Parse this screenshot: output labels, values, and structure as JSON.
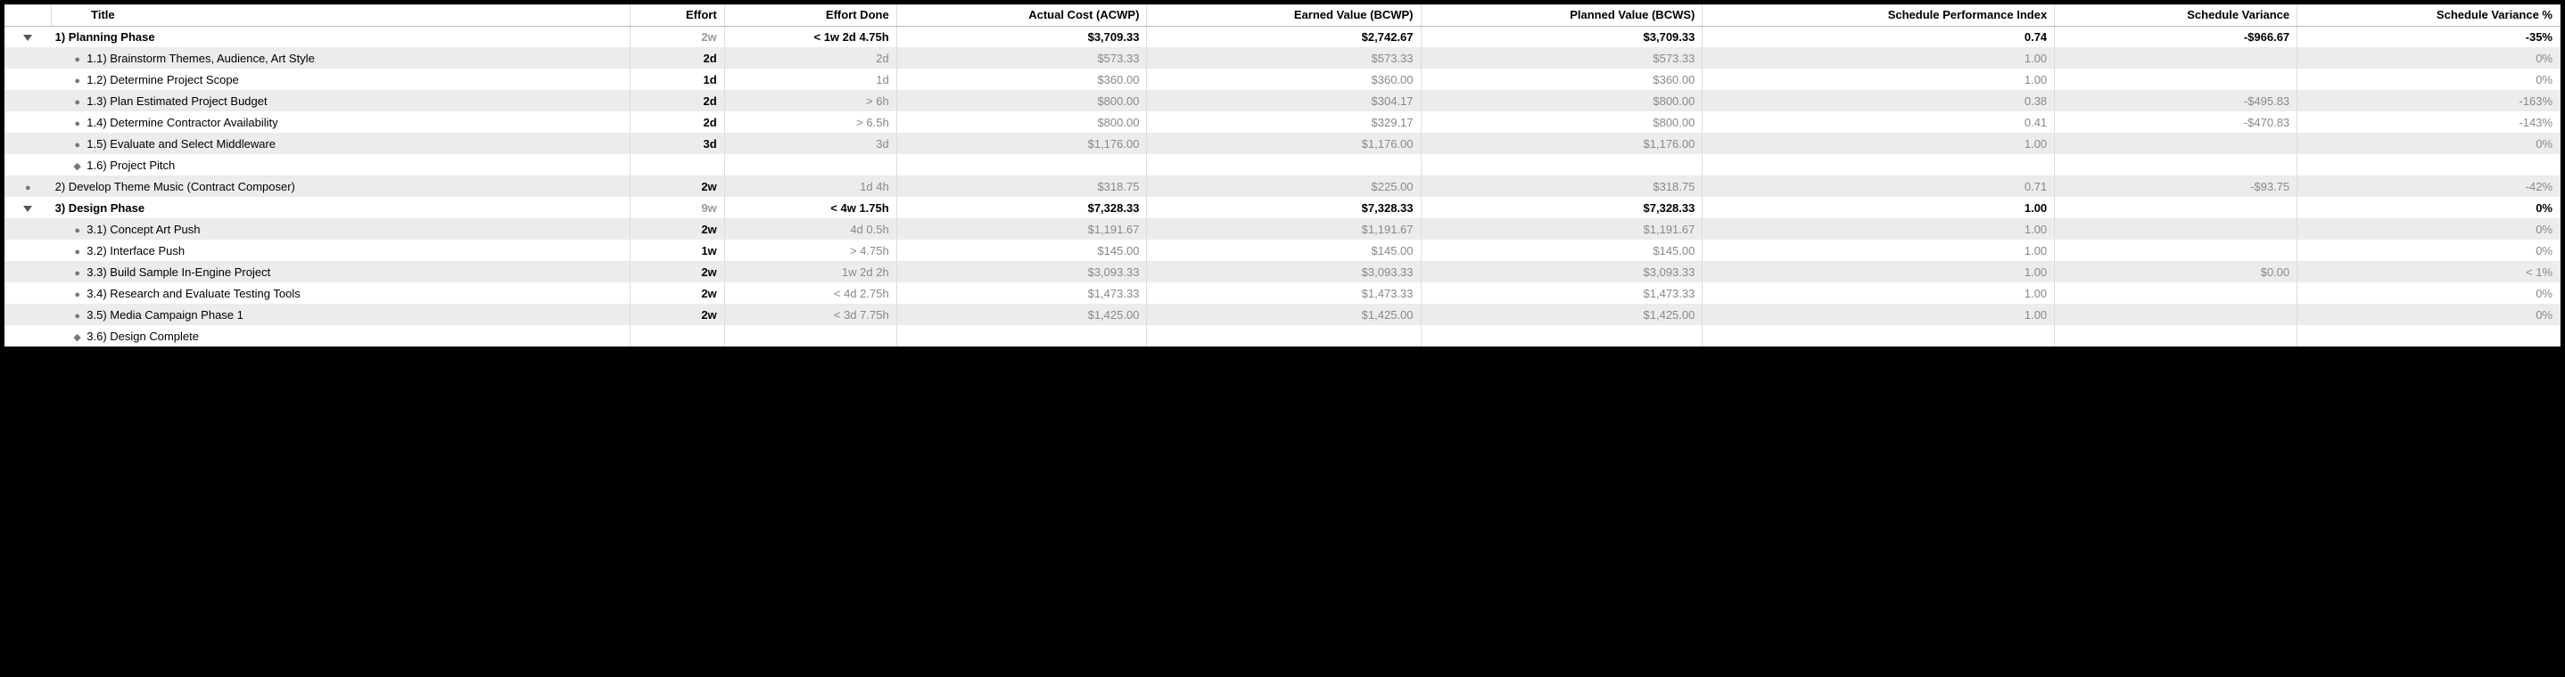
{
  "columns": {
    "title": "Title",
    "effort": "Effort",
    "effort_done": "Effort Done",
    "acwp": "Actual Cost (ACWP)",
    "bcwp": "Earned Value (BCWP)",
    "bcws": "Planned Value (BCWS)",
    "spi": "Schedule Performance Index",
    "sv": "Schedule Variance",
    "svp": "Schedule Variance %"
  },
  "rows": [
    {
      "icon": "tri-down",
      "indent": 0,
      "bold": true,
      "shaded": false,
      "title": "1)  Planning Phase",
      "effort": "2w",
      "effort_gray": true,
      "effdone": "< 1w 2d 4.75h",
      "acwp": "$3,709.33",
      "bcwp": "$2,742.67",
      "bcws": "$3,709.33",
      "spi": "0.74",
      "sv": "-$966.67",
      "svp": "-35%",
      "dark": true
    },
    {
      "icon": "bullet",
      "indent": 1,
      "bold": false,
      "shaded": true,
      "title": "1.1)  Brainstorm Themes, Audience, Art Style",
      "effort": "2d",
      "effdone": "2d",
      "acwp": "$573.33",
      "bcwp": "$573.33",
      "bcws": "$573.33",
      "spi": "1.00",
      "sv": "",
      "svp": "0%"
    },
    {
      "icon": "bullet",
      "indent": 1,
      "bold": false,
      "shaded": false,
      "title": "1.2)  Determine Project Scope",
      "effort": "1d",
      "effdone": "1d",
      "acwp": "$360.00",
      "bcwp": "$360.00",
      "bcws": "$360.00",
      "spi": "1.00",
      "sv": "",
      "svp": "0%"
    },
    {
      "icon": "bullet",
      "indent": 1,
      "bold": false,
      "shaded": true,
      "title": "1.3)  Plan Estimated Project Budget",
      "effort": "2d",
      "effdone": "> 6h",
      "acwp": "$800.00",
      "bcwp": "$304.17",
      "bcws": "$800.00",
      "spi": "0.38",
      "sv": "-$495.83",
      "svp": "-163%"
    },
    {
      "icon": "bullet",
      "indent": 1,
      "bold": false,
      "shaded": false,
      "title": "1.4)  Determine Contractor Availability",
      "effort": "2d",
      "effdone": "> 6.5h",
      "acwp": "$800.00",
      "bcwp": "$329.17",
      "bcws": "$800.00",
      "spi": "0.41",
      "sv": "-$470.83",
      "svp": "-143%"
    },
    {
      "icon": "bullet",
      "indent": 1,
      "bold": false,
      "shaded": true,
      "title": "1.5)  Evaluate and Select Middleware",
      "effort": "3d",
      "effdone": "3d",
      "acwp": "$1,176.00",
      "bcwp": "$1,176.00",
      "bcws": "$1,176.00",
      "spi": "1.00",
      "sv": "",
      "svp": "0%"
    },
    {
      "icon": "diamond",
      "indent": 1,
      "bold": false,
      "shaded": false,
      "title": "1.6)  Project Pitch",
      "effort": "",
      "effdone": "",
      "acwp": "",
      "bcwp": "",
      "bcws": "",
      "spi": "",
      "sv": "",
      "svp": ""
    },
    {
      "icon": "bullet",
      "indent": 0,
      "bold": false,
      "shaded": true,
      "title": "2)  Develop Theme Music (Contract Composer)",
      "effort": "2w",
      "effdone": "1d 4h",
      "acwp": "$318.75",
      "bcwp": "$225.00",
      "bcws": "$318.75",
      "spi": "0.71",
      "sv": "-$93.75",
      "svp": "-42%"
    },
    {
      "icon": "tri-down",
      "indent": 0,
      "bold": true,
      "shaded": false,
      "title": "3)  Design Phase",
      "effort": "9w",
      "effort_gray": true,
      "effdone": "< 4w 1.75h",
      "acwp": "$7,328.33",
      "bcwp": "$7,328.33",
      "bcws": "$7,328.33",
      "spi": "1.00",
      "sv": "",
      "svp": "0%",
      "dark": true
    },
    {
      "icon": "bullet",
      "indent": 1,
      "bold": false,
      "shaded": true,
      "title": "3.1)  Concept Art Push",
      "effort": "2w",
      "effdone": "4d 0.5h",
      "acwp": "$1,191.67",
      "bcwp": "$1,191.67",
      "bcws": "$1,191.67",
      "spi": "1.00",
      "sv": "",
      "svp": "0%"
    },
    {
      "icon": "bullet",
      "indent": 1,
      "bold": false,
      "shaded": false,
      "title": "3.2)  Interface Push",
      "effort": "1w",
      "effdone": "> 4.75h",
      "acwp": "$145.00",
      "bcwp": "$145.00",
      "bcws": "$145.00",
      "spi": "1.00",
      "sv": "",
      "svp": "0%"
    },
    {
      "icon": "bullet",
      "indent": 1,
      "bold": false,
      "shaded": true,
      "title": "3.3)  Build Sample In-Engine Project",
      "effort": "2w",
      "effdone": "1w 2d 2h",
      "acwp": "$3,093.33",
      "bcwp": "$3,093.33",
      "bcws": "$3,093.33",
      "spi": "1.00",
      "sv": "$0.00",
      "svp": "< 1%"
    },
    {
      "icon": "bullet",
      "indent": 1,
      "bold": false,
      "shaded": false,
      "title": "3.4)  Research and Evaluate Testing Tools",
      "effort": "2w",
      "effdone": "< 4d 2.75h",
      "acwp": "$1,473.33",
      "bcwp": "$1,473.33",
      "bcws": "$1,473.33",
      "spi": "1.00",
      "sv": "",
      "svp": "0%"
    },
    {
      "icon": "bullet",
      "indent": 1,
      "bold": false,
      "shaded": true,
      "title": "3.5)  Media Campaign Phase 1",
      "effort": "2w",
      "effdone": "< 3d 7.75h",
      "acwp": "$1,425.00",
      "bcwp": "$1,425.00",
      "bcws": "$1,425.00",
      "spi": "1.00",
      "sv": "",
      "svp": "0%"
    },
    {
      "icon": "diamond",
      "indent": 1,
      "bold": false,
      "shaded": false,
      "title": "3.6)  Design Complete",
      "effort": "",
      "effdone": "",
      "acwp": "",
      "bcwp": "",
      "bcws": "",
      "spi": "",
      "sv": "",
      "svp": ""
    }
  ]
}
